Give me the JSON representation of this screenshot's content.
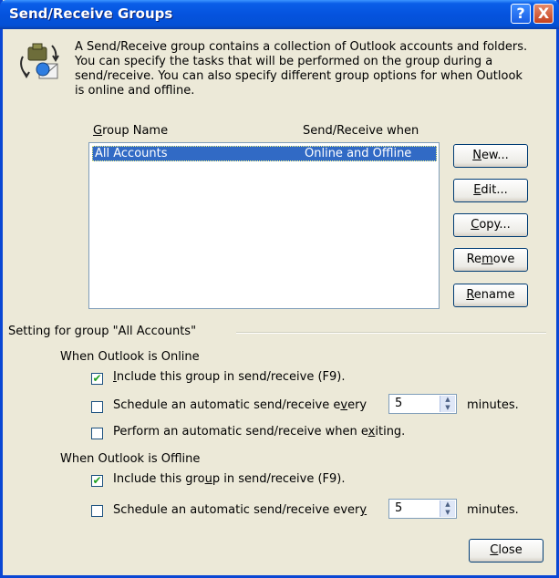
{
  "window": {
    "title": "Send/Receive Groups",
    "help_glyph": "?",
    "close_glyph": "X"
  },
  "description": "A Send/Receive group contains a collection of Outlook accounts and folders. You can specify the tasks that will be performed on the group during a send/receive. You can also specify different group options for when Outlook is online and offline.",
  "list": {
    "headers": [
      "Group Name",
      "Send/Receive when"
    ],
    "rows": [
      {
        "name": "All Accounts",
        "when": "Online and Offline"
      }
    ]
  },
  "buttons": {
    "new": "New...",
    "edit": "Edit...",
    "copy": "Copy...",
    "remove": "Remove",
    "rename": "Rename",
    "close": "Close"
  },
  "settings": {
    "group_label": "Setting for group \"All Accounts\"",
    "online": {
      "heading": "When Outlook is Online",
      "include_label": "Include this group in send/receive (F9).",
      "include_checked": true,
      "schedule_label": "Schedule an automatic send/receive every",
      "schedule_checked": false,
      "schedule_value": "5",
      "minutes_label": "minutes.",
      "exit_label": "Perform an automatic send/receive when exiting.",
      "exit_checked": false
    },
    "offline": {
      "heading": "When Outlook is Offline",
      "include_label": "Include this group in send/receive (F9).",
      "include_checked": true,
      "schedule_label": "Schedule an automatic send/receive every",
      "schedule_checked": false,
      "schedule_value": "5",
      "minutes_label": "minutes."
    }
  }
}
